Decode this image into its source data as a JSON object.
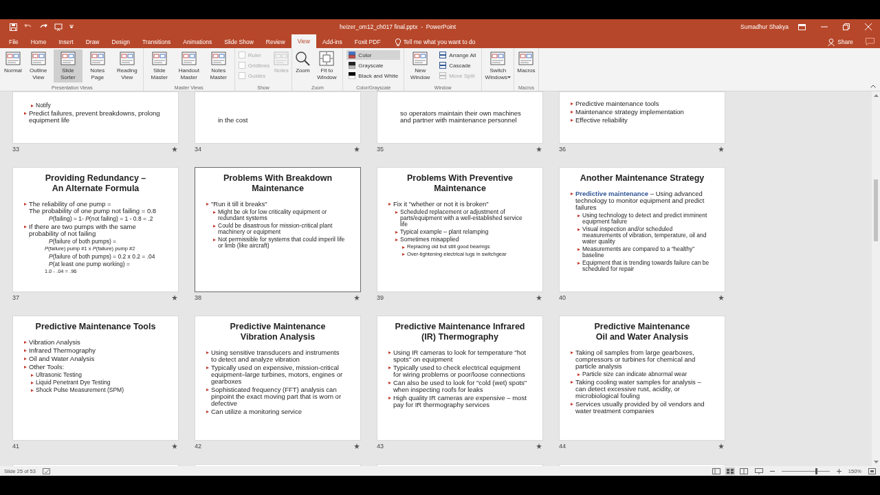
{
  "title_bar": {
    "title": "heizer_om12_ch017 final.pptx  -  PowerPoint",
    "user": "Sumadhur Shakya"
  },
  "tabs": [
    {
      "label": "File",
      "selected": false
    },
    {
      "label": "Home",
      "selected": false
    },
    {
      "label": "Insert",
      "selected": false
    },
    {
      "label": "Draw",
      "selected": false
    },
    {
      "label": "Design",
      "selected": false
    },
    {
      "label": "Transitions",
      "selected": false
    },
    {
      "label": "Animations",
      "selected": false
    },
    {
      "label": "Slide Show",
      "selected": false
    },
    {
      "label": "Review",
      "selected": false
    },
    {
      "label": "View",
      "selected": true
    },
    {
      "label": "Add-ins",
      "selected": false
    },
    {
      "label": "Foxit PDF",
      "selected": false
    }
  ],
  "tell_me": {
    "placeholder": "Tell me what you want to do"
  },
  "share": "Share",
  "ribbon": [
    {
      "label": "Presentation Views",
      "items": [
        {
          "kind": "large",
          "label": "Normal",
          "selected": false
        },
        {
          "kind": "large",
          "label": "Outline View",
          "selected": false
        },
        {
          "kind": "large",
          "label": "Slide Sorter",
          "selected": true
        },
        {
          "kind": "large",
          "label": "Notes Page",
          "selected": false
        },
        {
          "kind": "large",
          "label": "Reading View",
          "selected": false
        }
      ]
    },
    {
      "label": "Master Views",
      "items": [
        {
          "kind": "large",
          "label": "Slide Master"
        },
        {
          "kind": "large",
          "label": "Handout Master"
        },
        {
          "kind": "large",
          "label": "Notes Master"
        }
      ]
    },
    {
      "label": "Show",
      "items": [
        {
          "kind": "check",
          "label": "Ruler",
          "checked": false,
          "disabled": true
        },
        {
          "kind": "check",
          "label": "Gridlines",
          "checked": false,
          "disabled": true
        },
        {
          "kind": "check",
          "label": "Guides",
          "checked": false,
          "disabled": true
        },
        {
          "kind": "large",
          "label": "Notes",
          "disabled": true
        }
      ]
    },
    {
      "label": "Zoom",
      "items": [
        {
          "kind": "large",
          "label": "Zoom"
        },
        {
          "kind": "large",
          "label": "Fit to Window"
        }
      ]
    },
    {
      "label": "Color/Grayscale",
      "items": [
        {
          "kind": "small",
          "label": "Color",
          "selected": true
        },
        {
          "kind": "small",
          "label": "Grayscale",
          "selected": false
        },
        {
          "kind": "small",
          "label": "Black and White",
          "selected": false
        }
      ]
    },
    {
      "label": "Window",
      "items": [
        {
          "kind": "large",
          "label": "New Window"
        },
        {
          "kind": "small",
          "label": "Arrange All",
          "disabled": false
        },
        {
          "kind": "small",
          "label": "Cascade",
          "disabled": false
        },
        {
          "kind": "small",
          "label": "Move Split",
          "disabled": true
        }
      ]
    },
    {
      "items": [
        {
          "kind": "large",
          "label": "Switch Windows",
          "dropdown": true
        }
      ]
    },
    {
      "label": "Macros",
      "items": [
        {
          "kind": "large",
          "label": "Macros"
        }
      ]
    }
  ],
  "slide_rows": [
    {
      "kind": "cut_top",
      "slides": [
        {
          "number": "33",
          "selected": false,
          "bullets": [
            {
              "kind": "bullet",
              "children": [
                {
                  "kind": "bullet",
                  "text": "Notify"
                }
              ]
            },
            {
              "kind": "bullet",
              "text": "Predict failures, prevent breakdowns, prolong equipment life"
            }
          ]
        },
        {
          "number": "34",
          "selected": false,
          "bullets": [
            {
              "kind": "continuation",
              "text": "in the cost"
            }
          ]
        },
        {
          "number": "35",
          "selected": false,
          "bullets": [
            {
              "kind": "continuation",
              "text": "so operators maintain their own machines and partner with maintenance personnel"
            }
          ]
        },
        {
          "number": "36",
          "selected": false,
          "bullets": [
            {
              "kind": "bullet",
              "text": "Predictive maintenance tools"
            },
            {
              "kind": "bullet",
              "text": "Maintenance strategy implementation"
            },
            {
              "kind": "bullet",
              "text": "Effective reliability"
            }
          ]
        }
      ]
    },
    {
      "kind": "full",
      "slides": [
        {
          "number": "37",
          "selected": false,
          "title": "Providing Redundancy –\nAn Alternate Formula",
          "bullets": [
            {
              "kind": "bullet",
              "text": "The reliability of one pump =\nThe probability of one pump not failing = 0.8",
              "children": [
                {
                  "kind": "formula",
                  "text": "*P*(failing) = 1- *P*(not failing) = 1 - 0.8 = .2"
                }
              ]
            },
            {
              "kind": "bullet",
              "text": "If there are two pumps with the same\nprobability of not failing",
              "children": [
                {
                  "kind": "formula",
                  "text": "*P*(failure of both pumps) =",
                  "children": [
                    {
                      "kind": "formula",
                      "text": "*P*(failure) pump #1 x *P*(failure) pump #2"
                    }
                  ]
                },
                {
                  "kind": "formula",
                  "text": "*P*(failure of both pumps) = 0.2 x 0.2 = .04"
                },
                {
                  "kind": "formula",
                  "text": "*P*(at least one pump working) =",
                  "children": [
                    {
                      "kind": "formula",
                      "text": "1.0 - .04 = .96"
                    }
                  ]
                }
              ]
            }
          ]
        },
        {
          "number": "38",
          "selected": true,
          "title": "Problems With Breakdown\nMaintenance",
          "bullets": [
            {
              "kind": "bullet",
              "text": "\"Run it till it breaks\"",
              "children": [
                {
                  "kind": "bullet",
                  "text": "Might be ok for low criticality equipment or redundant systems"
                },
                {
                  "kind": "bullet",
                  "text": "Could be disastrous for mission-critical plant machinery or equipment"
                },
                {
                  "kind": "bullet",
                  "text": "Not permissible for systems that could imperil life or limb (like aircraft)"
                }
              ]
            }
          ]
        },
        {
          "number": "39",
          "selected": false,
          "title": "Problems With Preventive\nMaintenance",
          "bullets": [
            {
              "kind": "bullet",
              "text": "Fix it \"whether or not it is broken\"",
              "children": [
                {
                  "kind": "bullet",
                  "text": "Scheduled replacement or adjustment of parts/equipment with a well-established service life"
                },
                {
                  "kind": "bullet",
                  "text": "Typical example – plant relamping"
                },
                {
                  "kind": "bullet",
                  "text": "Sometimes misapplied",
                  "children": [
                    {
                      "kind": "bullet",
                      "text": "Replacing old but still good bearings"
                    },
                    {
                      "kind": "bullet",
                      "text": "Over-tightening electrical lugs in switchgear"
                    }
                  ]
                }
              ]
            }
          ]
        },
        {
          "number": "40",
          "selected": false,
          "title": "Another Maintenance Strategy",
          "bullets": [
            {
              "kind": "bullet",
              "text": "**Predictive maintenance** – Using advanced technology to monitor equipment and predict failures",
              "children": [
                {
                  "kind": "bullet",
                  "text": "Using technology to detect and predict imminent equipment failure"
                },
                {
                  "kind": "bullet",
                  "text": "Visual inspection and/or scheduled measurements of vibration, temperature, oil and water quality"
                },
                {
                  "kind": "bullet",
                  "text": "Measurements are compared to a “healthy” baseline"
                },
                {
                  "kind": "bullet",
                  "text": "Equipment that is trending towards failure can be scheduled for repair"
                }
              ]
            }
          ]
        }
      ]
    },
    {
      "kind": "full",
      "slides": [
        {
          "number": "41",
          "selected": false,
          "title": "Predictive Maintenance Tools",
          "bullets": [
            {
              "kind": "bullet",
              "text": "Vibration Analysis"
            },
            {
              "kind": "bullet",
              "text": "Infrared Thermography"
            },
            {
              "kind": "bullet",
              "text": "Oil and Water Analysis"
            },
            {
              "kind": "bullet",
              "text": "Other Tools:",
              "children": [
                {
                  "kind": "bullet",
                  "text": "Ultrasonic Testing"
                },
                {
                  "kind": "bullet",
                  "text": "Liquid Penetrant Dye Testing"
                },
                {
                  "kind": "bullet",
                  "text": "Shock Pulse Measurement (SPM)"
                }
              ]
            }
          ]
        },
        {
          "number": "42",
          "selected": false,
          "title": "Predictive Maintenance\nVibration Analysis",
          "bullets": [
            {
              "kind": "bullet",
              "text": "Using sensitive transducers and instruments to detect and analyze vibration"
            },
            {
              "kind": "bullet",
              "text": "Typically used on expensive, mission-critical equipment–large turbines, motors, engines or gearboxes"
            },
            {
              "kind": "bullet",
              "text": "Sophisticated frequency (FFT) analysis can pinpoint the exact moving part that is worn or defective"
            },
            {
              "kind": "bullet",
              "text": "Can utilize a monitoring service"
            }
          ]
        },
        {
          "number": "43",
          "selected": false,
          "title": "Predictive Maintenance Infrared\n(IR) Thermography",
          "bullets": [
            {
              "kind": "bullet",
              "text": "Using IR cameras to look for temperature \"hot spots\" on equipment"
            },
            {
              "kind": "bullet",
              "text": "Typically used to check electrical equipment for wiring problems or poor/loose connections"
            },
            {
              "kind": "bullet",
              "text": "Can also be used to look for \"cold (wet) spots\" when inspecting roofs for leaks"
            },
            {
              "kind": "bullet",
              "text": "High quality IR cameras are expensive – most pay for IR thermography services"
            }
          ]
        },
        {
          "number": "44",
          "selected": false,
          "title": "Predictive Maintenance\nOil and Water Analysis",
          "bullets": [
            {
              "kind": "bullet",
              "text": "Taking oil samples from large gearboxes, compressors or turbines for chemical and particle analysis",
              "children": [
                {
                  "kind": "bullet",
                  "text": "Particle size can indicate abnormal wear"
                }
              ]
            },
            {
              "kind": "bullet",
              "text": "Taking cooling water samples for analysis – can detect excessive rust, acidity, or microbiological fouling"
            },
            {
              "kind": "bullet",
              "text": "Services usually provided by oil vendors and water treatment companies"
            }
          ]
        }
      ]
    },
    {
      "kind": "cut_bottom",
      "slides": [
        {
          "selected": false
        },
        {
          "selected": false
        },
        {
          "selected": false
        },
        {
          "selected": false
        }
      ]
    }
  ],
  "status_bar": {
    "slide": "Slide 25 of 53",
    "zoom": "150%",
    "zoom_slider": {
      "level": 0.72
    }
  }
}
